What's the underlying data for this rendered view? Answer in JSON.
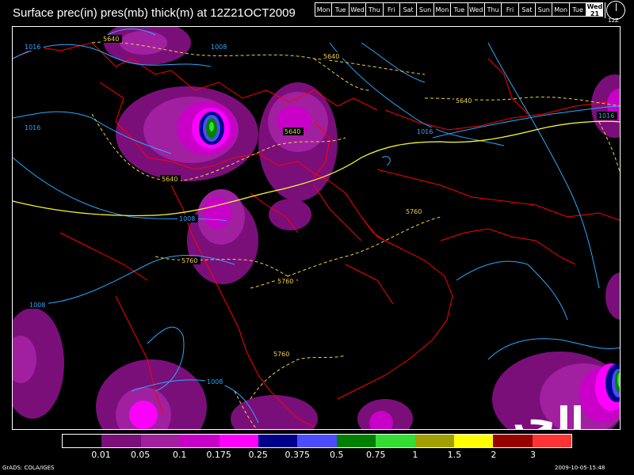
{
  "header": {
    "title": "Surface prec(in) pres(mb) thick(m) at 12Z21OCT2009",
    "days": [
      "Mon",
      "Tue",
      "Wed",
      "Thu",
      "Fri",
      "Sat",
      "Sun",
      "Mon",
      "Tue",
      "Wed",
      "Thu",
      "Fri",
      "Sat",
      "Sun",
      "Mon",
      "Tue"
    ],
    "active_day": {
      "label": "Wed",
      "date": "21"
    },
    "clock_label": "12Z"
  },
  "map": {
    "contour_labels": {
      "pressure": [
        "1016",
        "1008",
        "1016",
        "1008",
        "1008",
        "1016",
        "1016",
        "1008"
      ],
      "thickness": [
        "5640",
        "5640",
        "5640",
        "5640",
        "5640",
        "5760",
        "5760",
        "5760",
        "5760"
      ]
    },
    "colors": {
      "pressure_contour": "#2aa8ff",
      "thickness_contour": "#f0d040",
      "thickness_5700_contour": "#ffff33",
      "borders": "#ff0000",
      "land_water_background": "#000000"
    }
  },
  "legend": {
    "colors": [
      "#000000",
      "#7a0f7a",
      "#a020a0",
      "#c800c8",
      "#ff00ff",
      "#00008b",
      "#4b4bff",
      "#008000",
      "#33dd33",
      "#a0a000",
      "#ffff00",
      "#990000",
      "#ff3333"
    ],
    "labels": [
      "0.01",
      "0.05",
      "0.1",
      "0.175",
      "0.25",
      "0.375",
      "0.5",
      "0.75",
      "1",
      "1.5",
      "2",
      "3"
    ]
  },
  "footer": {
    "left": "GrADS: COLA/IGES",
    "right": "2009-10-05-15:48"
  },
  "watermark": {
    "text": "الحر"
  }
}
